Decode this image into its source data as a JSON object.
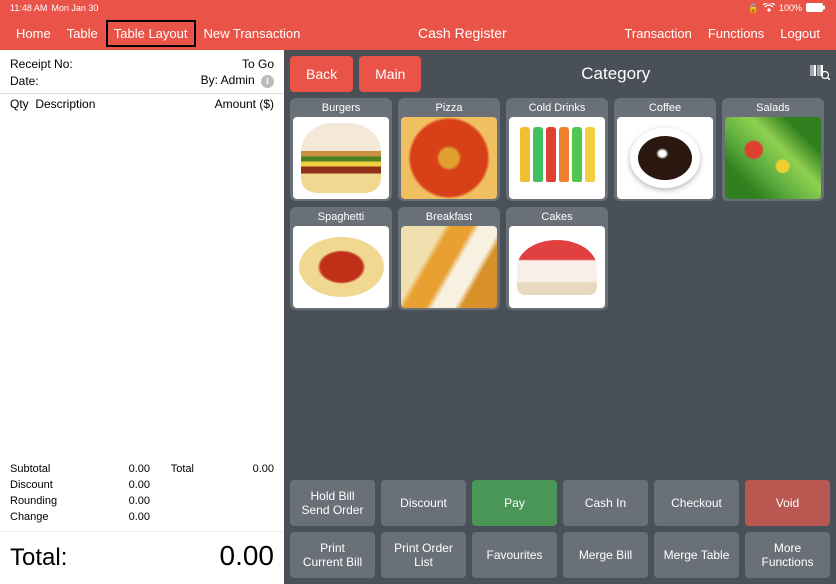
{
  "status": {
    "time": "11:48 AM",
    "date": "Mon Jan 30",
    "battery": "100%"
  },
  "nav": {
    "home": "Home",
    "table": "Table",
    "tableLayout": "Table Layout",
    "newTrans": "New Transaction",
    "center": "Cash Register",
    "transaction": "Transaction",
    "functions": "Functions",
    "logout": "Logout"
  },
  "receipt": {
    "receiptNoLbl": "Receipt No:",
    "receiptNoVal": "To Go",
    "dateLbl": "Date:",
    "byVal": "By: Admin",
    "qtyLbl": "Qty",
    "descLbl": "Description",
    "amountLbl": "Amount ($)",
    "subtotalLbl": "Subtotal",
    "subtotalVal": "0.00",
    "totalLbl": "Total",
    "totalVal": "0.00",
    "discountLbl": "Discount",
    "discountVal": "0.00",
    "roundingLbl": "Rounding",
    "roundingVal": "0.00",
    "changeLbl": "Change",
    "changeVal": "0.00",
    "grandLbl": "Total:",
    "grandVal": "0.00"
  },
  "main": {
    "back": "Back",
    "mainBtn": "Main",
    "category": "Category",
    "cats": [
      "Burgers",
      "Pizza",
      "Cold Drinks",
      "Coffee",
      "Salads",
      "Spaghetti",
      "Breakfast",
      "Cakes"
    ]
  },
  "fns": {
    "holdBill1": "Hold Bill",
    "holdBill2": "Send Order",
    "discount": "Discount",
    "pay": "Pay",
    "cashIn": "Cash In",
    "checkout": "Checkout",
    "void": "Void",
    "printCurrent1": "Print",
    "printCurrent2": "Current Bill",
    "printOrder1": "Print Order",
    "printOrder2": "List",
    "favourites": "Favourites",
    "mergeBill": "Merge Bill",
    "mergeTable": "Merge Table",
    "more1": "More",
    "more2": "Functions"
  }
}
